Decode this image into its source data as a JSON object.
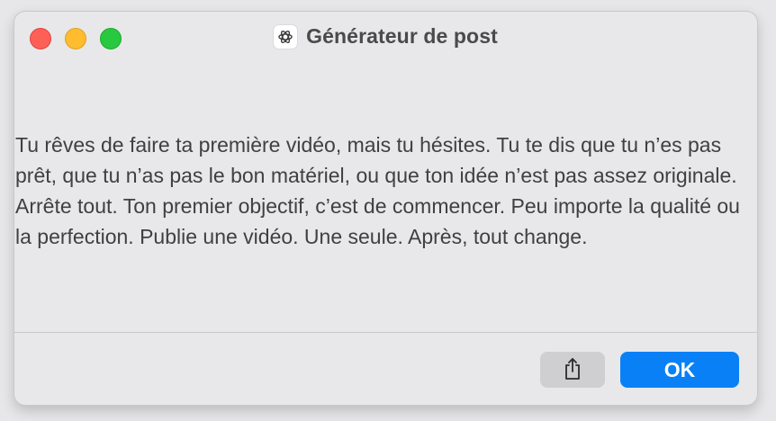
{
  "window": {
    "title": "Générateur de post",
    "app_icon": "openai-logo-icon"
  },
  "message": {
    "text": "Tu rêves de faire ta première vidéo, mais tu hésites. Tu te dis que tu n’es pas prêt, que tu n’as pas le bon matériel, ou que ton idée n’est pas assez originale. Arrête tout. Ton premier objectif, c’est de commencer. Peu importe la qualité ou la perfection. Publie une vidéo. Une seule. Après, tout change."
  },
  "buttons": {
    "share_icon": "share-icon",
    "ok_label": "OK"
  },
  "colors": {
    "accent": "#0a80f6",
    "close": "#fe5f57",
    "minimize": "#febc2e",
    "maximize": "#28c840"
  }
}
